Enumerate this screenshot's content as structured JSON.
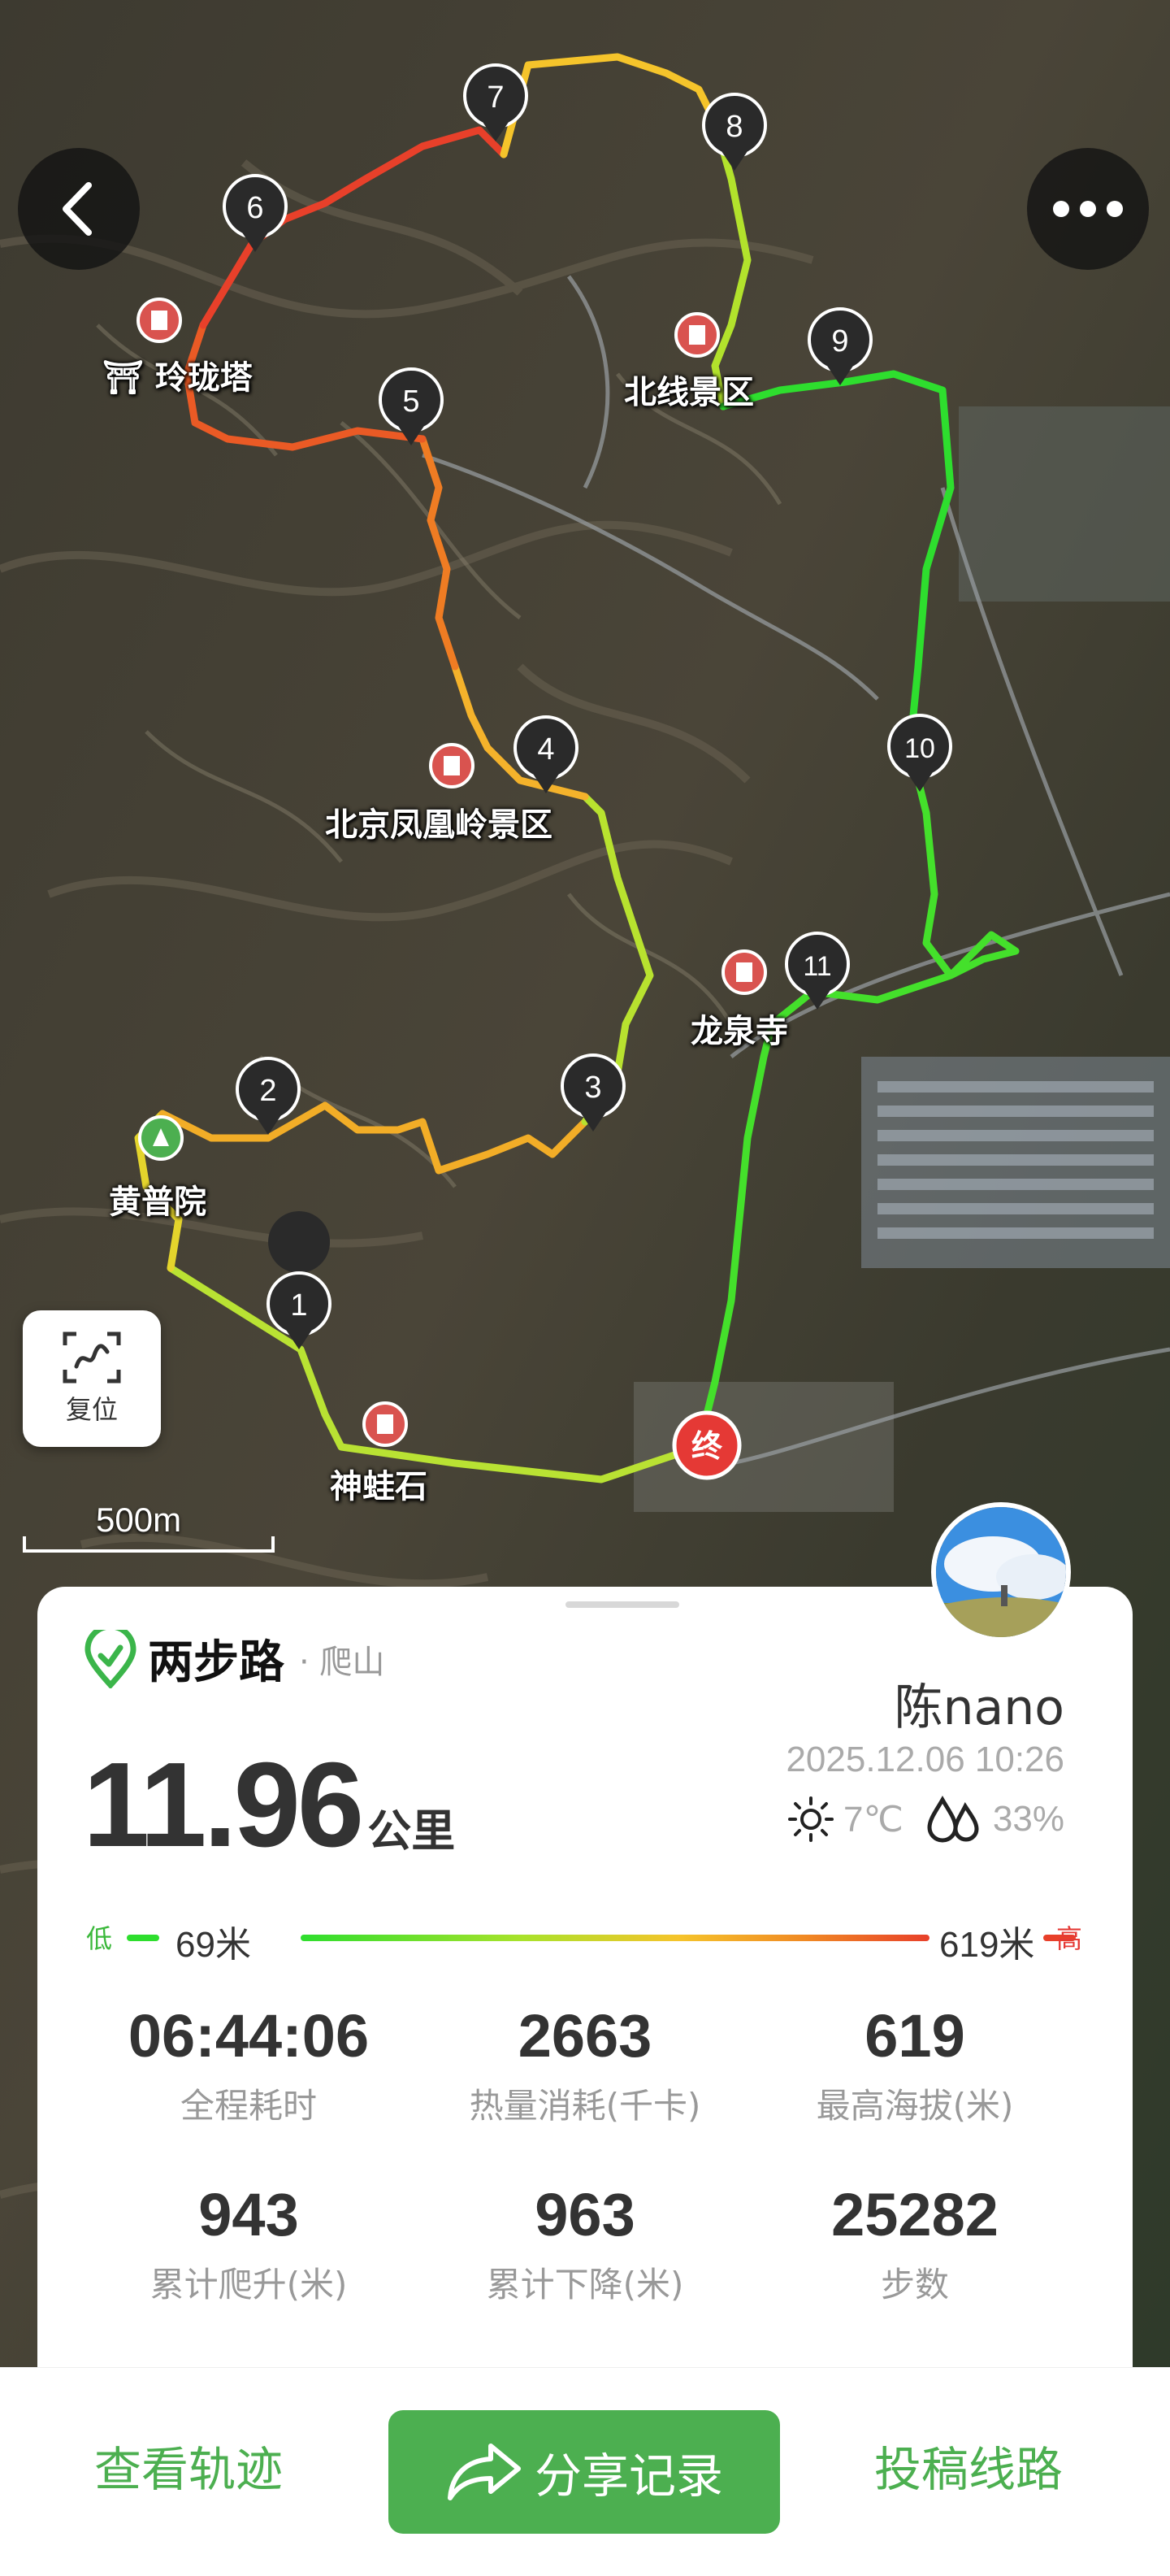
{
  "map": {
    "pois": [
      {
        "name": "玲珑塔"
      },
      {
        "name": "北线景区"
      },
      {
        "name": "北京凤凰岭景区"
      },
      {
        "name": "龙泉寺"
      },
      {
        "name": "黄普院"
      },
      {
        "name": "神蛙石"
      }
    ],
    "markers": [
      "1",
      "2",
      "3",
      "4",
      "5",
      "6",
      "7",
      "8",
      "9",
      "10",
      "11"
    ],
    "end_marker": "终",
    "scale_label": "500m",
    "reset_label": "复位"
  },
  "card": {
    "brand_name": "两步路",
    "activity": "· 爬山",
    "distance_value": "11.96",
    "distance_unit": "公里",
    "username": "陈nano",
    "datetime": "2025.12.06 10:26",
    "temperature": "7℃",
    "humidity": "33%",
    "elevation": {
      "low_label": "低",
      "high_label": "高",
      "min": "69米",
      "max": "619米"
    },
    "stats": [
      {
        "value": "06:44:06",
        "label": "全程耗时"
      },
      {
        "value": "2663",
        "label": "热量消耗(千卡)"
      },
      {
        "value": "619",
        "label": "最高海拔(米)"
      },
      {
        "value": "943",
        "label": "累计爬升(米)"
      },
      {
        "value": "963",
        "label": "累计下降(米)"
      },
      {
        "value": "25282",
        "label": "步数"
      }
    ]
  },
  "bottom_bar": {
    "view_track": "查看轨迹",
    "share_record": "分享记录",
    "submit_route": "投稿线路"
  },
  "colors": {
    "accent": "#4caf50",
    "track_low": "#2ede2e",
    "track_high": "#e8402a",
    "end_marker": "#e53935"
  }
}
